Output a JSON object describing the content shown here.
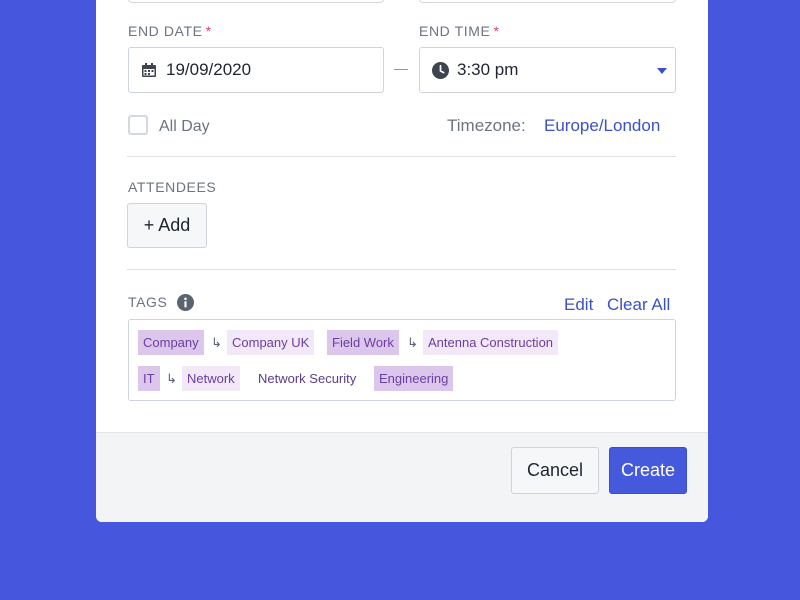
{
  "colors": {
    "background": "#4657dd",
    "link": "#3a52c4",
    "required": "#e03e6a",
    "primary_button": "#4459dc",
    "tag_dark": "#dcc6ec",
    "tag_light": "#f2e8f7"
  },
  "end_date": {
    "label": "END DATE",
    "required_mark": "*",
    "value": "19/09/2020",
    "icon": "calendar-icon"
  },
  "end_time": {
    "label": "END TIME",
    "required_mark": "*",
    "value": "3:30 pm",
    "icon": "clock-icon"
  },
  "all_day": {
    "label": "All Day",
    "checked": false
  },
  "timezone": {
    "label": "Timezone:",
    "value": "Europe/London"
  },
  "attendees": {
    "label": "ATTENDEES",
    "add_label": "+ Add"
  },
  "tags": {
    "label": "TAGS",
    "info_icon": "info-icon",
    "edit_label": "Edit",
    "clear_label": "Clear All",
    "arrow": "↳",
    "items": [
      {
        "text": "Company"
      },
      {
        "text": "Company UK"
      },
      {
        "text": "Field Work"
      },
      {
        "text": "Antenna Construction"
      },
      {
        "text": "IT"
      },
      {
        "text": "Network"
      },
      {
        "text": "Network Security"
      },
      {
        "text": "Engineering"
      }
    ]
  },
  "footer": {
    "cancel_label": "Cancel",
    "create_label": "Create"
  }
}
